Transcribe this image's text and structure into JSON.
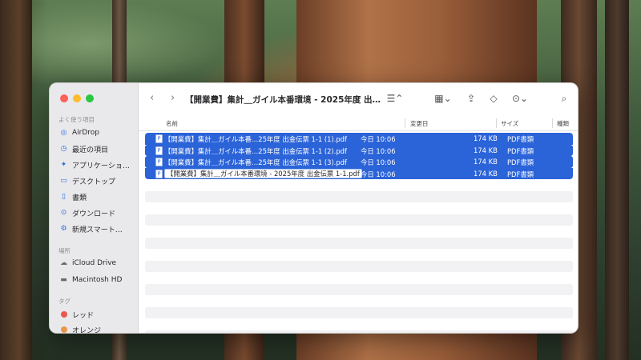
{
  "window": {
    "title": "【開業費】集計＿ガイル本番環境 - 2025年度 出…"
  },
  "sidebar": {
    "favorites_title": "よく使う項目",
    "favorites": [
      {
        "label": "AirDrop",
        "icon": "airdrop-icon"
      },
      {
        "label": "最近の項目",
        "icon": "clock-icon"
      },
      {
        "label": "アプリケーショ…",
        "icon": "applications-icon"
      },
      {
        "label": "デスクトップ",
        "icon": "desktop-icon"
      },
      {
        "label": "書類",
        "icon": "document-icon"
      },
      {
        "label": "ダウンロード",
        "icon": "download-icon"
      },
      {
        "label": "新規スマート…",
        "icon": "smart-folder-icon"
      }
    ],
    "locations_title": "場所",
    "locations": [
      {
        "label": "iCloud Drive",
        "icon": "cloud-icon"
      },
      {
        "label": "Macintosh HD",
        "icon": "disk-icon"
      }
    ],
    "tags_title": "タグ",
    "tags": [
      {
        "label": "レッド",
        "color": "#e8584f"
      },
      {
        "label": "オレンジ",
        "color": "#e8964a"
      }
    ]
  },
  "columns": {
    "name": "名前",
    "modified": "変更日",
    "size": "サイズ",
    "kind": "種類"
  },
  "files": [
    {
      "name": "【開業費】集計＿ガイル本番…25年度 出金伝票 1-1 (1).pdf",
      "modified": "今日 10:06",
      "size": "174 KB",
      "kind": "PDF書類",
      "selected": true
    },
    {
      "name": "【開業費】集計＿ガイル本番…25年度 出金伝票 1-1 (2).pdf",
      "modified": "今日 10:06",
      "size": "174 KB",
      "kind": "PDF書類",
      "selected": true
    },
    {
      "name": "【開業費】集計＿ガイル本番…25年度 出金伝票 1-1 (3).pdf",
      "modified": "今日 10:06",
      "size": "174 KB",
      "kind": "PDF書類",
      "selected": true
    },
    {
      "name": "【開業費】集計＿ガイル本番環境 - 2025年度 出金伝票 1-1.pdf",
      "modified": "今日 10:06",
      "size": "174 KB",
      "kind": "PDF書類",
      "selected": true,
      "renaming": true
    }
  ],
  "colors": {
    "selection": "#2b63d8",
    "accent_icon": "#2d6fde"
  }
}
